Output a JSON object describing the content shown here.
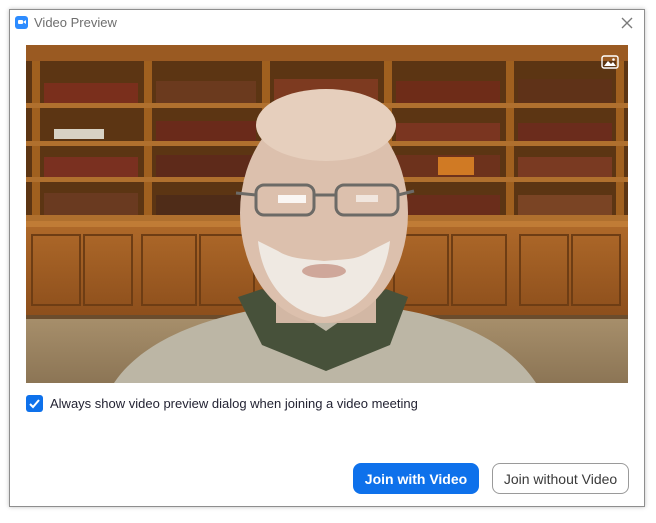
{
  "window": {
    "title": "Video Preview",
    "icon": "zoom-camera-icon",
    "close_icon": "close-icon"
  },
  "preview": {
    "background_toggle_icon": "image-icon"
  },
  "option": {
    "checked": true,
    "label": "Always show video preview dialog when joining a video meeting"
  },
  "buttons": {
    "join_with_video": "Join with Video",
    "join_without_video": "Join without Video"
  },
  "colors": {
    "accent": "#0e71eb"
  }
}
